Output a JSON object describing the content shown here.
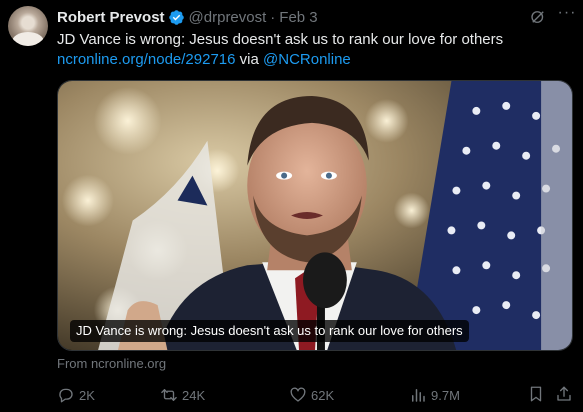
{
  "author": {
    "name": "Robert Prevost",
    "handle": "@drprevost",
    "separator": "·",
    "date": "Feb 3"
  },
  "post": {
    "text": "JD Vance is wrong: Jesus doesn't ask us to rank our love for others",
    "link": "ncronline.org/node/292716",
    "via_word": "via",
    "mention": "@NCRonline"
  },
  "card": {
    "caption": "JD Vance is wrong: Jesus doesn't ask us to rank our love for others",
    "source": "From ncronline.org"
  },
  "actions": {
    "replies": "2K",
    "reposts": "24K",
    "likes": "62K",
    "views": "9.7M"
  },
  "icons": [
    "verified-badge-icon",
    "grok-icon",
    "more-icon",
    "reply-icon",
    "repost-icon",
    "like-icon",
    "views-icon",
    "bookmark-icon",
    "share-icon"
  ],
  "colors": {
    "background": "#000000",
    "text": "#e7e9ea",
    "muted": "#71767b",
    "link": "#1d9bf0"
  }
}
